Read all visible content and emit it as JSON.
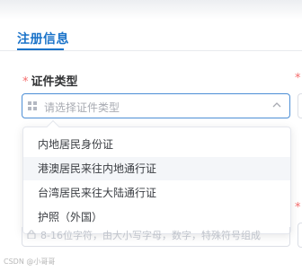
{
  "tab": {
    "label": "注册信息"
  },
  "form": {
    "cert_type": {
      "required_mark": "*",
      "label": "证件类型",
      "placeholder": "请选择证件类型",
      "options": [
        "内地居民身份证",
        "港澳居民来往内地通行证",
        "台湾居民来往大陆通行证",
        "护照（外国）"
      ],
      "hovered_option": 1
    },
    "right_required_mark": "*",
    "password": {
      "placeholder": "8-16位字符，由大小写字母，数字，特殊符号组成"
    }
  },
  "watermark": "CSDN @小哥哥",
  "colors": {
    "accent": "#1a73c9",
    "required": "#f56c6c",
    "placeholder": "#a8abb2"
  }
}
